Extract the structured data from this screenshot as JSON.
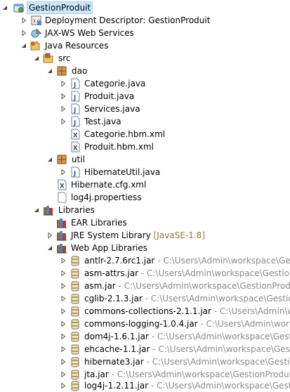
{
  "colors": {
    "selection": "#cce8ff",
    "decoration": "#8a8a8a",
    "qualifier": "#8c7b3a"
  },
  "tree": {
    "project": {
      "label": "GestionProduit",
      "icon": "web-project-icon"
    },
    "deployment_descriptor": {
      "label": "Deployment Descriptor: GestionProduit",
      "icon": "deployment-descriptor-icon"
    },
    "jaxws": {
      "label": "JAX-WS Web Services",
      "icon": "web-services-icon"
    },
    "java_resources": {
      "label": "Java Resources",
      "icon": "java-resources-icon"
    },
    "src": {
      "label": "src",
      "icon": "source-folder-icon"
    },
    "dao": {
      "label": "dao",
      "icon": "package-icon",
      "files": [
        {
          "label": "Categorie.java",
          "icon": "java-file-icon"
        },
        {
          "label": "Produit.java",
          "icon": "java-file-icon"
        },
        {
          "label": "Services.java",
          "icon": "java-file-icon"
        },
        {
          "label": "Test.java",
          "icon": "java-file-icon"
        },
        {
          "label": "Categorie.hbm.xml",
          "icon": "xml-file-icon"
        },
        {
          "label": "Produit.hbm.xml",
          "icon": "xml-file-icon"
        }
      ]
    },
    "util": {
      "label": "util",
      "icon": "package-icon",
      "files": [
        {
          "label": "HibernateUtil.java",
          "icon": "java-file-icon"
        }
      ]
    },
    "hibernate_cfg": {
      "label": "Hibernate.cfg.xml",
      "icon": "xml-file-icon"
    },
    "log4j_props": {
      "label": "log4j.propertiess",
      "icon": "properties-file-icon"
    },
    "libraries": {
      "label": "Libraries",
      "icon": "libraries-icon"
    },
    "ear_libraries": {
      "label": "EAR Libraries",
      "icon": "library-icon"
    },
    "jre_library": {
      "label": "JRE System Library",
      "qualifier": "[JavaSE-1.8]",
      "icon": "library-icon"
    },
    "webapp_libraries": {
      "label": "Web App Libraries",
      "icon": "library-icon"
    },
    "jars": [
      {
        "name": "antlr-2.7.6rc1.jar",
        "path": " - C:\\Users\\Admin\\workspace\\GestionProduit\\WebContent\\WEB-INF\\lib"
      },
      {
        "name": "asm-attrs.jar",
        "path": " - C:\\Users\\Admin\\workspace\\GestionProduit\\WebContent\\WEB-INF\\lib"
      },
      {
        "name": "asm.jar",
        "path": " - C:\\Users\\Admin\\workspace\\GestionProduit\\WebContent\\WEB-INF\\lib"
      },
      {
        "name": "cglib-2.1.3.jar",
        "path": " - C:\\Users\\Admin\\workspace\\GestionProduit\\WebContent\\WEB-INF\\lib"
      },
      {
        "name": "commons-collections-2.1.1.jar",
        "path": " - C:\\Users\\Admin\\workspace\\GestionProduit\\WebContent\\WEB-INF\\lib"
      },
      {
        "name": "commons-logging-1.0.4.jar",
        "path": " - C:\\Users\\Admin\\workspace\\GestionProduit\\WebContent\\WEB-INF\\lib"
      },
      {
        "name": "dom4j-1.6.1.jar",
        "path": " - C:\\Users\\Admin\\workspace\\GestionProduit\\WebContent\\WEB-INF\\lib"
      },
      {
        "name": "ehcache-1.1.jar",
        "path": " - C:\\Users\\Admin\\workspace\\GestionProduit\\WebContent\\WEB-INF\\lib"
      },
      {
        "name": "hibernate3.jar",
        "path": " - C:\\Users\\Admin\\workspace\\GestionProduit\\WebContent\\WEB-INF\\lib"
      },
      {
        "name": "jta.jar",
        "path": " - C:\\Users\\Admin\\workspace\\GestionProduit\\WebContent\\WEB-INF\\lib"
      },
      {
        "name": "log4j-1.2.11.jar",
        "path": " - C:\\Users\\Admin\\workspace\\GestionProduit\\WebContent\\WEB-INF\\lib"
      }
    ]
  }
}
